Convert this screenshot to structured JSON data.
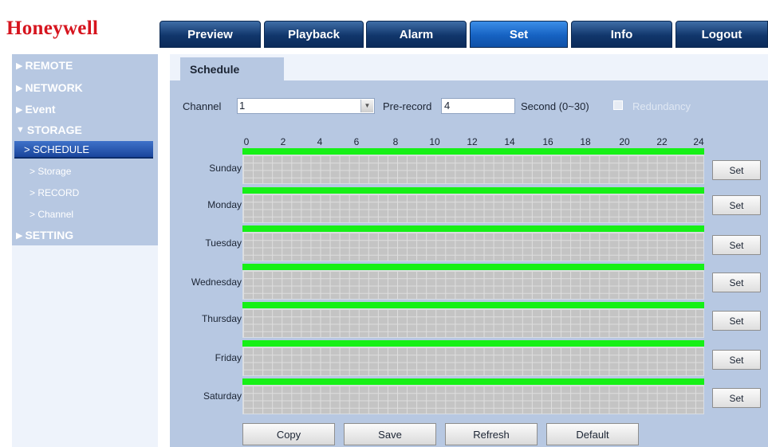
{
  "brand": {
    "logo_text": "Honeywell",
    "logo_color": "#d6141e"
  },
  "nav": {
    "tabs": [
      {
        "label": "Preview"
      },
      {
        "label": "Playback"
      },
      {
        "label": "Alarm"
      },
      {
        "label": "Set",
        "active": true
      },
      {
        "label": "Info"
      },
      {
        "label": "Logout"
      }
    ]
  },
  "sidebar": {
    "items": [
      {
        "label": "REMOTE",
        "icon": "triangle-right-icon"
      },
      {
        "label": "NETWORK",
        "icon": "triangle-right-icon"
      },
      {
        "label": "Event",
        "icon": "triangle-right-icon"
      },
      {
        "label": "STORAGE",
        "icon": "triangle-down-icon",
        "expanded": true
      },
      {
        "label": "> SCHEDULE",
        "active": true
      },
      {
        "label": "> Storage"
      },
      {
        "label": "> RECORD"
      },
      {
        "label": "> Channel"
      },
      {
        "label": "SETTING",
        "icon": "triangle-right-icon"
      }
    ]
  },
  "page": {
    "tab_label": "Schedule",
    "channel_label": "Channel",
    "channel_value": "1",
    "prerecord_label": "Pre-record",
    "prerecord_value": "4",
    "second_label": "Second (0~30)",
    "redundancy_label": "Redundancy",
    "redundancy_checked": false
  },
  "schedule": {
    "hour_labels": [
      "0",
      "2",
      "4",
      "6",
      "8",
      "10",
      "12",
      "14",
      "16",
      "18",
      "20",
      "22",
      "24"
    ],
    "days": [
      {
        "label": "Sunday",
        "set_label": "Set"
      },
      {
        "label": "Monday",
        "set_label": "Set"
      },
      {
        "label": "Tuesday",
        "set_label": "Set"
      },
      {
        "label": "Wednesday",
        "set_label": "Set"
      },
      {
        "label": "Thursday",
        "set_label": "Set"
      },
      {
        "label": "Friday",
        "set_label": "Set"
      },
      {
        "label": "Saturday",
        "set_label": "Set"
      }
    ],
    "recording_color": "#16f016"
  },
  "actions": {
    "copy": "Copy",
    "save": "Save",
    "refresh": "Refresh",
    "default": "Default"
  }
}
